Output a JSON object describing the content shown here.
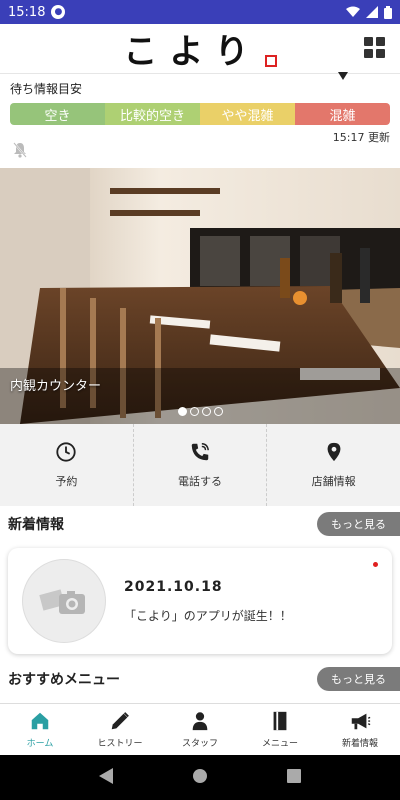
{
  "status_bar": {
    "time": "15:18"
  },
  "header": {
    "logo_text": "こより"
  },
  "wait_info": {
    "title": "待ち情報目安",
    "levels": [
      "空き",
      "比較的空き",
      "やや混雑",
      "混雑"
    ],
    "current_level": "混雑",
    "updated": "15:17 更新"
  },
  "hero": {
    "caption": "内観カウンター",
    "slide_count": 4,
    "active_slide": 1
  },
  "actions": [
    {
      "label": "予約",
      "icon": "clock-icon"
    },
    {
      "label": "電話する",
      "icon": "phone-icon"
    },
    {
      "label": "店舗情報",
      "icon": "map-pin-icon"
    }
  ],
  "news": {
    "title": "新着情報",
    "more_label": "もっと見る",
    "items": [
      {
        "date": "2021.10.18",
        "text": "「こより」のアプリが誕生！！",
        "icon": "photo-placeholder-icon"
      }
    ]
  },
  "recommend": {
    "title": "おすすめメニュー",
    "more_label": "もっと見る"
  },
  "bottom_nav": [
    {
      "label": "ホーム",
      "icon": "home-icon",
      "active": true
    },
    {
      "label": "ヒストリー",
      "icon": "pencil-icon",
      "active": false
    },
    {
      "label": "スタッフ",
      "icon": "person-icon",
      "active": false
    },
    {
      "label": "メニュー",
      "icon": "book-icon",
      "active": false
    },
    {
      "label": "新着情報",
      "icon": "megaphone-icon",
      "active": false
    }
  ],
  "colors": {
    "status_bar": "#3a3fb8",
    "level_empty": "#96c47a",
    "level_fairly_empty": "#aed073",
    "level_slightly_busy": "#ead068",
    "level_busy": "#e3776b",
    "accent": "#2a9fa3"
  }
}
